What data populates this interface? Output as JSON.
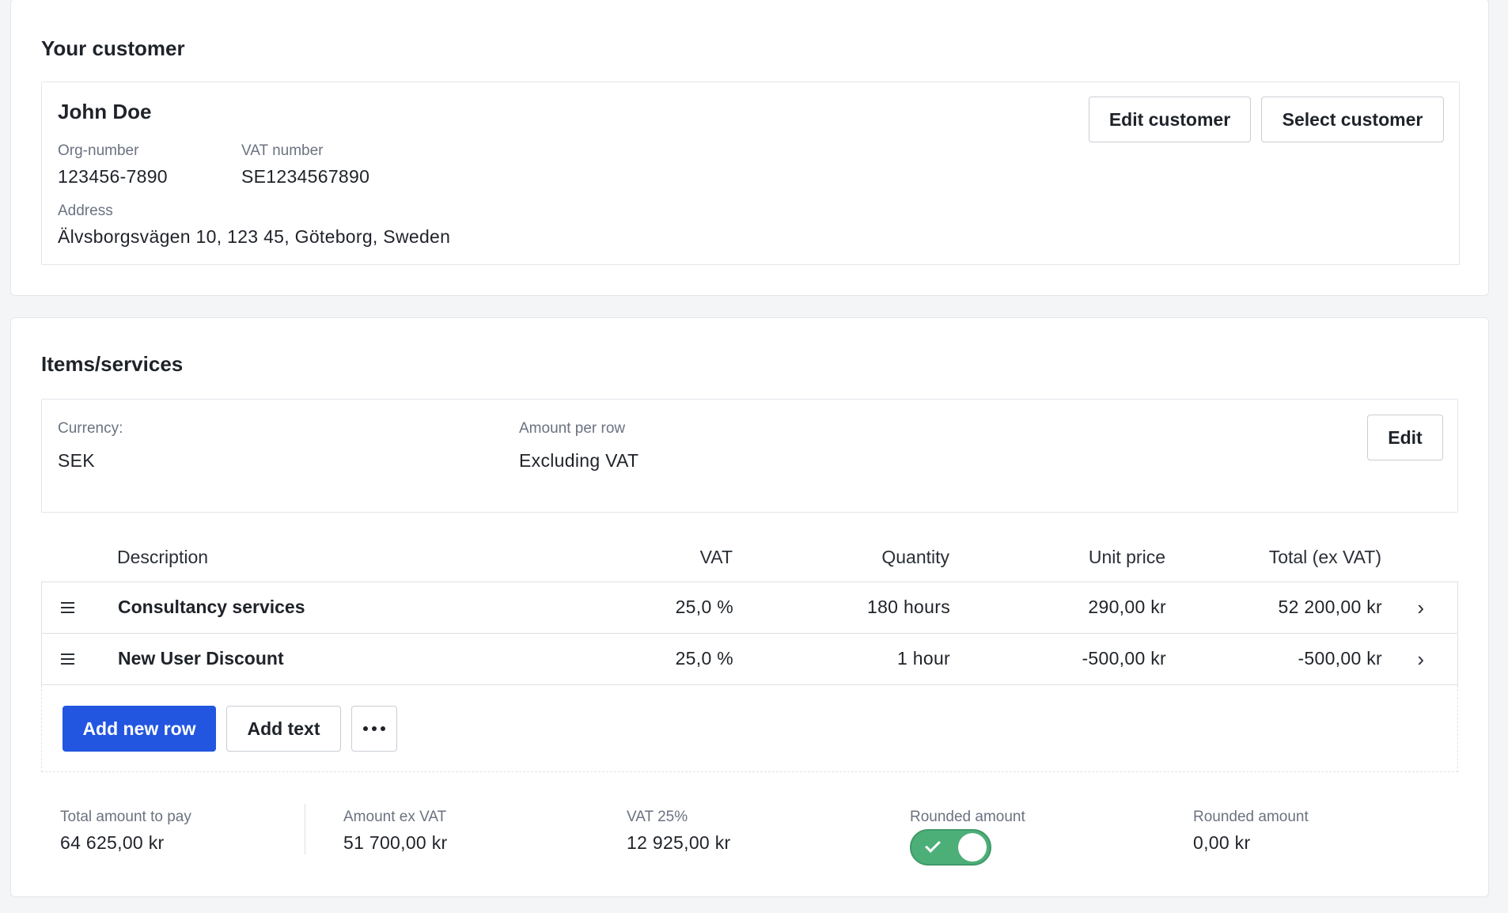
{
  "customer_section": {
    "title": "Your customer",
    "name": "John Doe",
    "org_label": "Org-number",
    "org_value": "123456-7890",
    "vat_label": "VAT number",
    "vat_value": "SE1234567890",
    "address_label": "Address",
    "address_value": "Älvsborgsvägen 10, 123 45, Göteborg, Sweden",
    "edit_button": "Edit customer",
    "select_button": "Select customer"
  },
  "items_section": {
    "title": "Items/services",
    "currency_label": "Currency:",
    "currency_value": "SEK",
    "amount_label": "Amount per row",
    "amount_value": "Excluding VAT",
    "edit_button": "Edit",
    "columns": {
      "description": "Description",
      "vat": "VAT",
      "quantity": "Quantity",
      "unit_price": "Unit price",
      "total": "Total (ex VAT)"
    },
    "rows": [
      {
        "description": "Consultancy services",
        "vat": "25,0 %",
        "quantity": "180 hours",
        "unit_price": "290,00 kr",
        "total": "52 200,00 kr"
      },
      {
        "description": "New User Discount",
        "vat": "25,0 %",
        "quantity": "1 hour",
        "unit_price": "-500,00 kr",
        "total": "-500,00 kr"
      }
    ],
    "add_row_button": "Add new row",
    "add_text_button": "Add text"
  },
  "summary": {
    "total_label": "Total amount to pay",
    "total_value": "64 625,00 kr",
    "ex_vat_label": "Amount ex VAT",
    "ex_vat_value": "51 700,00 kr",
    "vat_label": "VAT 25%",
    "vat_value": "12 925,00 kr",
    "rounded_toggle_label": "Rounded amount",
    "rounded_toggle_on": true,
    "rounded_label": "Rounded amount",
    "rounded_value": "0,00 kr"
  },
  "colors": {
    "primary": "#2356e0",
    "toggle_on": "#4caf78",
    "page_bg": "#f4f5f7"
  },
  "icons": {
    "drag_handle": "drag-handle-icon",
    "row_chevron": "chevron-right-icon",
    "more": "more-horizontal-icon",
    "toggle_check": "check-icon"
  }
}
